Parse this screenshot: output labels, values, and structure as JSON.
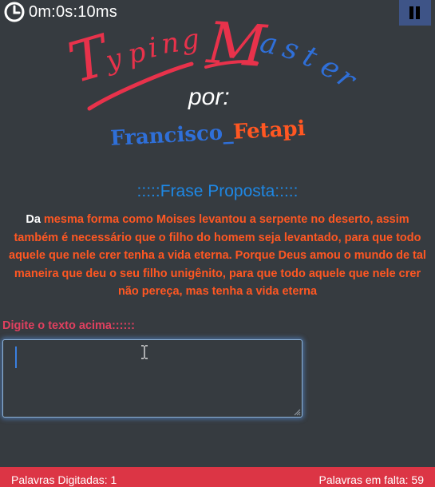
{
  "timer": {
    "icon": "clock-icon",
    "value": "0m:0s:10ms"
  },
  "pause": {
    "icon": "pause-icon",
    "color": "#3e5487"
  },
  "logo": {
    "title_letters": [
      "T",
      "y",
      "p",
      "i",
      "n",
      "g",
      "M",
      "a",
      "s",
      "t",
      "e",
      "r"
    ],
    "by": "por:",
    "author_first": "Francisco",
    "author_sep": "_",
    "author_last": "Fetapi",
    "colors": {
      "title_red": "#e8324b",
      "title_blue": "#2f6fd8",
      "author_blue": "#2f6fd8",
      "author_orange": "#ff5722"
    }
  },
  "phrase_section": {
    "title": ":::::Frase Proposta:::::",
    "typed": "Da",
    "pending": " mesma forma como Moises levantou a serpente no deserto, assim também é necessário que o filho do homem seja levantado, para que todo aquele que nele crer tenha a vida eterna. Porque Deus amou o mundo de tal maneira que deu o seu filho unigênito, para que todo aquele que nele crer não pereça, mas tenha a vida eterna",
    "colors": {
      "title": "#1e88e5",
      "typed": "#ffffff",
      "pending": "#ff5722"
    }
  },
  "input": {
    "label": "Digite o texto acima::::::",
    "value": "",
    "label_color": "#e0405f"
  },
  "footer": {
    "words_typed_label": "Palavras Digitadas: ",
    "words_typed": "1",
    "words_left_label": "Palavras em falta: ",
    "words_left": "59",
    "color": "#dc3545"
  }
}
